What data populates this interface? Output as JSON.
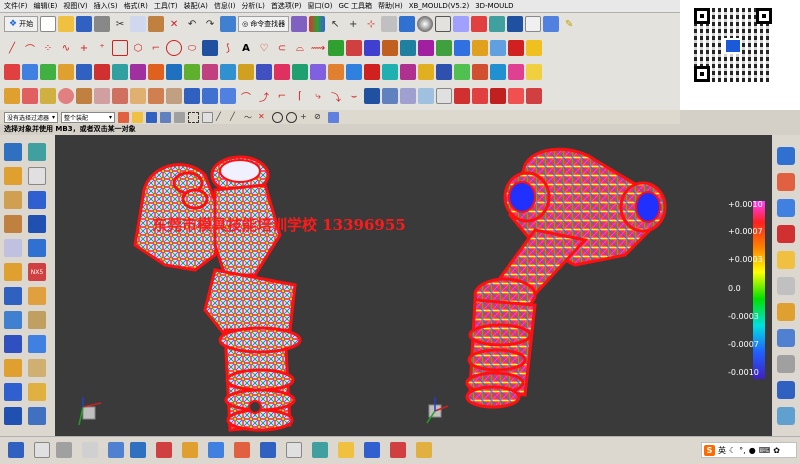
{
  "menu": [
    "文件(F)",
    "编辑(E)",
    "视图(V)",
    "插入(S)",
    "格式(R)",
    "工具(T)",
    "装配(A)",
    "信息(I)",
    "分析(L)",
    "首选项(P)",
    "窗口(O)",
    "GC 工具箱",
    "帮助(H)",
    "XB_MOULD(V5.2)",
    "3D-MOULD"
  ],
  "toolbar": {
    "start_label": "开始",
    "command_finder_label": "命令查找器"
  },
  "selection_bar": {
    "filter_value": "没有选择过滤器",
    "scope_value": "整个装配"
  },
  "prompt": "选择对象并使用 MB3，或者双击某一对象",
  "watermark": "东莞市模具技能培训学校 13396955",
  "legend": {
    "labels": [
      "+0.0010",
      "+0.0007",
      "+0.0003",
      "0.0",
      "-0.0003",
      "-0.0007",
      "-0.0010"
    ]
  },
  "left_dock": {
    "nx5_label": "NX5"
  },
  "ime": {
    "brand": "S",
    "lang": "英"
  },
  "colors": {
    "viewport_bg": "#3a3a3a",
    "watermark": "#ff1a1a",
    "legend_text": "#ffffff"
  }
}
